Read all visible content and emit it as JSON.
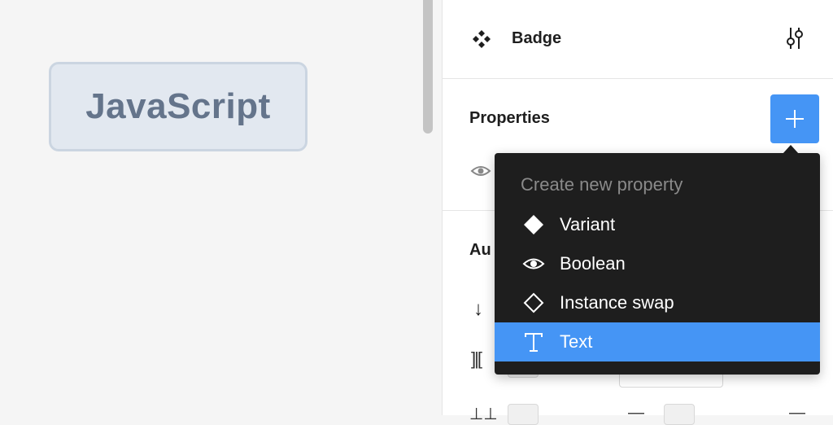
{
  "canvas": {
    "badge_text": "JavaScript"
  },
  "panel": {
    "component": {
      "name": "Badge",
      "icon": "component-icon"
    },
    "properties_title": "Properties",
    "add_button_icon": "plus-icon",
    "autolayout_title_partial": "Au"
  },
  "menu": {
    "header": "Create new property",
    "items": [
      {
        "label": "Variant",
        "icon": "diamond-filled-icon",
        "selected": false
      },
      {
        "label": "Boolean",
        "icon": "eye-icon",
        "selected": false
      },
      {
        "label": "Instance swap",
        "icon": "diamond-outline-icon",
        "selected": false
      },
      {
        "label": "Text",
        "icon": "text-icon",
        "selected": true
      }
    ]
  },
  "colors": {
    "accent": "#4595f5",
    "menu_bg": "#1e1e1e",
    "badge_bg": "#e2e8f0",
    "badge_text": "#64748b"
  }
}
